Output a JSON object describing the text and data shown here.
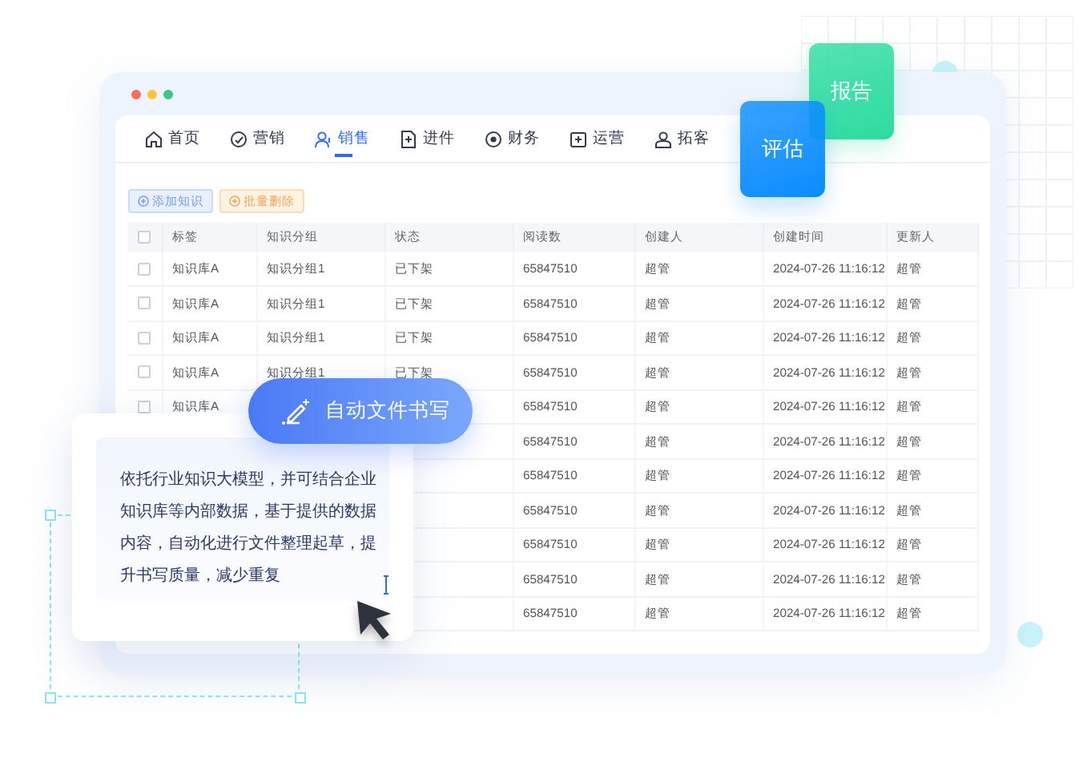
{
  "window": {
    "tabs": [
      {
        "label": "首页",
        "selected": false
      },
      {
        "label": "营销",
        "selected": false
      },
      {
        "label": "销售",
        "selected": true
      },
      {
        "label": "进件",
        "selected": false
      },
      {
        "label": "财务",
        "selected": false
      },
      {
        "label": "运营",
        "selected": false
      },
      {
        "label": "拓客",
        "selected": false
      }
    ],
    "buttons": [
      {
        "label": "添加知识",
        "kind": "primary"
      },
      {
        "label": "批量删除",
        "kind": "warning"
      }
    ],
    "table": {
      "header_checked": false,
      "columns": [
        "标签",
        "知识分组",
        "状态",
        "阅读数",
        "创建人",
        "创建时间",
        "更新人"
      ],
      "rows": [
        {
          "checked": false,
          "tag": "知识库A",
          "group": "知识分组1",
          "status": "已下架",
          "reads": "65847510",
          "creator": "超管",
          "created": "2024-07-26 11:16:12",
          "updater": "超管"
        },
        {
          "checked": false,
          "tag": "知识库A",
          "group": "知识分组1",
          "status": "已下架",
          "reads": "65847510",
          "creator": "超管",
          "created": "2024-07-26 11:16:12",
          "updater": "超管"
        },
        {
          "checked": false,
          "tag": "知识库A",
          "group": "知识分组1",
          "status": "已下架",
          "reads": "65847510",
          "creator": "超管",
          "created": "2024-07-26 11:16:12",
          "updater": "超管"
        },
        {
          "checked": false,
          "tag": "知识库A",
          "group": "知识分组1",
          "status": "已下架",
          "reads": "65847510",
          "creator": "超管",
          "created": "2024-07-26 11:16:12",
          "updater": "超管"
        },
        {
          "checked": false,
          "tag": "知识库A",
          "reads": "65847510",
          "creator": "超管",
          "created": "2024-07-26 11:16:12",
          "updater": "超管"
        },
        {
          "reads": "65847510",
          "creator": "超管",
          "created": "2024-07-26 11:16:12",
          "updater": "超管"
        },
        {
          "reads": "65847510",
          "creator": "超管",
          "created": "2024-07-26 11:16:12",
          "updater": "超管"
        },
        {
          "reads": "65847510",
          "creator": "超管",
          "created": "2024-07-26 11:16:12",
          "updater": "超管"
        },
        {
          "reads": "65847510",
          "creator": "超管",
          "created": "2024-07-26 11:16:12",
          "updater": "超管"
        },
        {
          "reads": "65847510",
          "creator": "超管",
          "created": "2024-07-26 11:16:12",
          "updater": "超管"
        },
        {
          "reads": "65847510",
          "creator": "超管",
          "created": "2024-07-26 11:16:12",
          "updater": "超管"
        }
      ]
    }
  },
  "feature_badge": "自动文件书写",
  "description": "依托行业知识大模型，并可结合企业知识库等内部数据，基于提供的数据内容，自动化进行文件整理起草，提升书写质量，减少重复",
  "notes": [
    {
      "label": "报告",
      "color": "#2cdca0"
    },
    {
      "label": "评估",
      "color": "#0a8cff"
    }
  ]
}
